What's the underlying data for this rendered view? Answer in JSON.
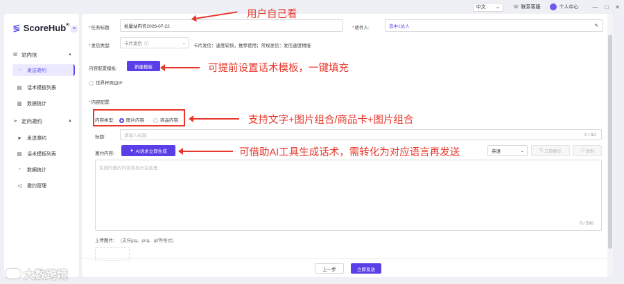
{
  "topbar": {
    "language": "中文",
    "support": "联系客服",
    "user_center": "个人中心",
    "win_min": "—",
    "win_max": "□",
    "win_close": "✕"
  },
  "sidebar": {
    "logo_text": "ScoreHub",
    "logo_sup": "AI",
    "groups": [
      {
        "label": "站内信",
        "items": [
          "发送邀约",
          "话术模板列表",
          "数据统计"
        ]
      },
      {
        "label": "定向邀约",
        "items": [
          "发送邀约",
          "话术模板列表",
          "数据统计",
          "邀约管理"
        ]
      }
    ]
  },
  "form": {
    "task_title_label": "任务标题:",
    "task_title_value": "批量站内信2026-07-22",
    "recipient_label": "收件人:",
    "recipient_value": "选中1达人",
    "send_type_label": "发信类型:",
    "send_type_value": "卡片发信",
    "send_type_desc": "卡片发信：速度较快，推荐使用；常规发信：发信速度稍慢",
    "template_label": "内容配置模板:",
    "template_button": "新建模板",
    "world_cup_ip": "世界杯周边IP",
    "content_config_label": "内容配置:",
    "content_type_label": "内容类型:",
    "content_type_options": [
      "图片内容",
      "商品内容"
    ],
    "title_label": "标题:",
    "title_placeholder": "请输入标题",
    "title_counter": "0 / 50",
    "invite_label": "邀约内容:",
    "ai_button": "AI话术立即生成",
    "lang_select": "英语",
    "translate_button": "立即翻译",
    "copy_button": "复制",
    "content_placeholder": "生成的邀约内容将显示在这里",
    "content_counter": "0 / 500",
    "upload_label": "上传图片:",
    "upload_hint": "(支持jpg、png、gif等格式)",
    "prev_button": "上一步",
    "send_button": "立即发送"
  },
  "annotations": {
    "a1": "用户自己看",
    "a2": "可提前设置话术模板，一键填充",
    "a3": "支持文字+图片组合/商品卡+图片组合",
    "a4": "可借助AI工具生成话术，需转化为对应语言再发送"
  },
  "watermark": "大数跨境",
  "colors": {
    "accent": "#5a3fe8",
    "annotation": "#e8362a"
  }
}
